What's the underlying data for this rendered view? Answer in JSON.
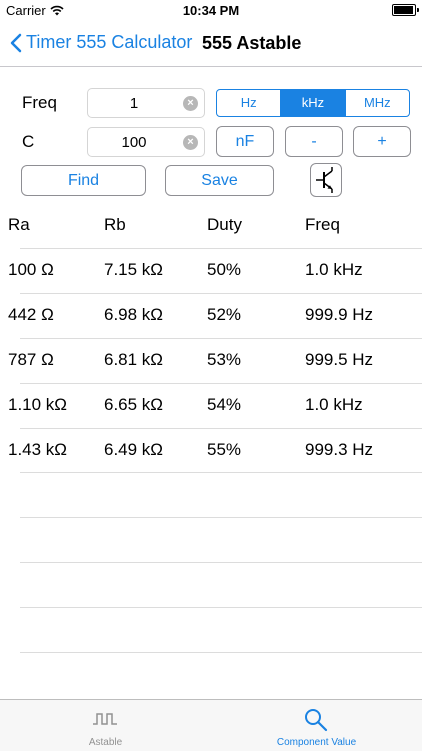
{
  "status": {
    "carrier": "Carrier",
    "time": "10:34 PM"
  },
  "nav": {
    "back_label": "Timer 555 Calculator",
    "title": "555 Astable"
  },
  "form": {
    "freq_label": "Freq",
    "freq_value": "1",
    "freq_units": [
      "Hz",
      "kHz",
      "MHz"
    ],
    "freq_unit_selected": "kHz",
    "c_label": "C",
    "c_value": "100",
    "c_unit": "nF",
    "minus": "-",
    "plus": "+",
    "find": "Find",
    "save": "Save"
  },
  "table": {
    "headers": [
      "Ra",
      "Rb",
      "Duty",
      "Freq"
    ],
    "rows": [
      [
        "100 Ω",
        "7.15 kΩ",
        "50%",
        "1.0 kHz"
      ],
      [
        "442 Ω",
        "6.98 kΩ",
        "52%",
        "999.9 Hz"
      ],
      [
        "787 Ω",
        "6.81 kΩ",
        "53%",
        "999.5 Hz"
      ],
      [
        "1.10 kΩ",
        "6.65 kΩ",
        "54%",
        "1.0 kHz"
      ],
      [
        "1.43 kΩ",
        "6.49 kΩ",
        "55%",
        "999.3 Hz"
      ]
    ]
  },
  "tabs": {
    "astable": "Astable",
    "component_value": "Component Value",
    "selected": "Component Value"
  },
  "colors": {
    "accent": "#1a82e2",
    "inactive": "#929292"
  }
}
